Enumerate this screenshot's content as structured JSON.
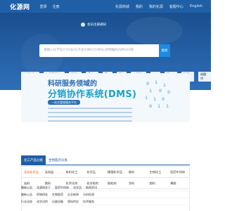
{
  "topbar": {
    "logo": "化源网",
    "nav_left": [
      "登录",
      "注册"
    ],
    "nav_right": [
      "化源商城",
      "我的",
      "我的化源",
      "客服中心",
      "English"
    ]
  },
  "hero": {
    "notice": "会员注册通知",
    "search_placeholder": "请输入化学名/CAS号/分子式/EINECS/MDL/药物编码/SMILES等",
    "search_button": "搜索",
    "categories": [
      "热门化学品",
      "三甲基氯化硅",
      "丙烯腈",
      "乙二醇",
      "乙醇",
      "甲醛",
      "二氯甲烷",
      "丁酮",
      "正丁醇",
      "碳酸钠",
      "碳酸钙"
    ]
  },
  "banner": {
    "title_top": "科研服务领域的",
    "title_main": "分销协作系统(DMS)",
    "pill": "一站式管理服务平台",
    "lines_count": 4
  },
  "tabs": [
    {
      "label": "化工产品分类",
      "active": true
    },
    {
      "label": "生物医药分类",
      "active": false
    }
  ],
  "grid": [
    [
      "无机化学品",
      "无机盐",
      "有机化工",
      "化学品",
      "精细化学品",
      "香料",
      "生物化工",
      "医药中间体"
    ],
    [
      "染料",
      "颜料",
      "化学试剂",
      "化学助剂",
      "胶粘剂",
      "涂料",
      "塑料",
      "橡胶"
    ],
    [
      "高分子材料",
      "天然产物",
      "农药",
      "生化试剂",
      "分析试剂",
      "其他",
      "",
      ""
    ]
  ],
  "highlight_cell": "无机化学品",
  "announcements": [
    [
      "最新公告",
      "化源网关于",
      "医药中间体",
      "化学品",
      "新闻资讯"
    ],
    [
      "最新公告",
      "药物研发",
      "生物医药",
      "企业新闻",
      "分析检测"
    ],
    [
      "行业动态",
      "化学试剂",
      "仪器设备",
      "原料供应",
      "技术服务"
    ]
  ]
}
